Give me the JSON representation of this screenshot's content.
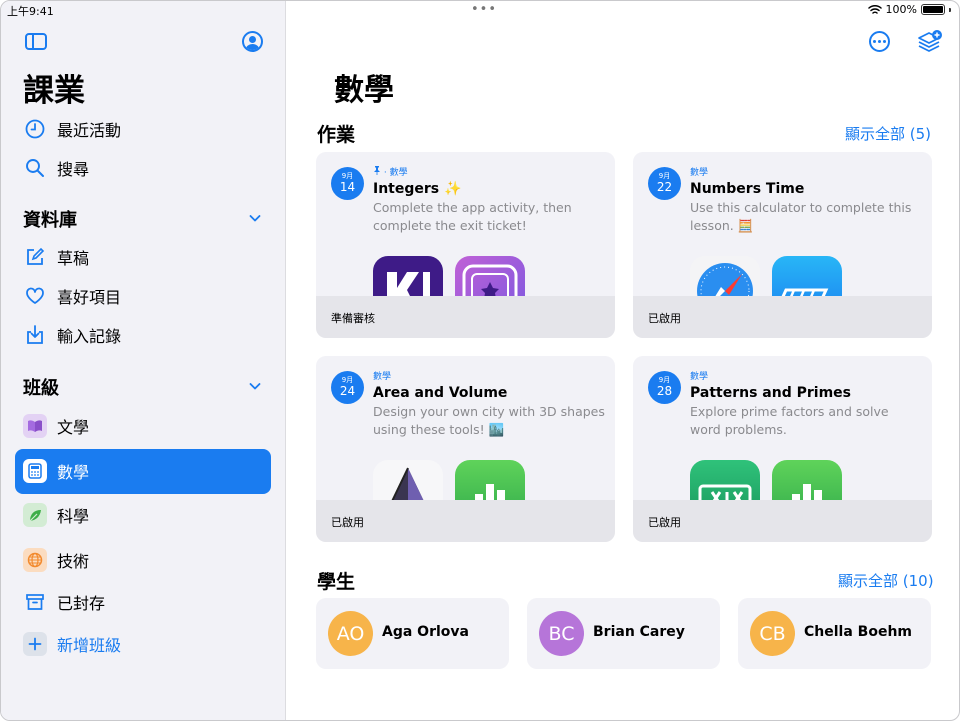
{
  "status_bar": {
    "time": "上午9:41",
    "battery": "100%"
  },
  "sidebar": {
    "title": "課業",
    "nav": [
      {
        "label": "最近活動",
        "icon": "clock-icon"
      },
      {
        "label": "搜尋",
        "icon": "search-icon"
      }
    ],
    "library": {
      "heading": "資料庫",
      "items": [
        {
          "label": "草稿",
          "icon": "compose-icon"
        },
        {
          "label": "喜好項目",
          "icon": "heart-icon"
        },
        {
          "label": "輸入記錄",
          "icon": "import-icon"
        }
      ]
    },
    "classes": {
      "heading": "班級",
      "items": [
        {
          "label": "文學",
          "icon": "book-icon",
          "color": "#a46be0"
        },
        {
          "label": "數學",
          "icon": "calculator-icon",
          "color": "#1a7cf0",
          "selected": true
        },
        {
          "label": "科學",
          "icon": "leaf-icon",
          "color": "#3fae49"
        },
        {
          "label": "技術",
          "icon": "globe-icon",
          "color": "#f28a2e"
        }
      ],
      "archived": "已封存",
      "add": "新增班級"
    }
  },
  "main": {
    "title": "數學",
    "assignments": {
      "heading": "作業",
      "show_all": "顯示全部 (5)",
      "cards": [
        {
          "month": "9月",
          "day": "14",
          "subject": "· 數學",
          "pinned": true,
          "title": "Integers ✨",
          "desc": "Complete the app activity, then complete the exit ticket!",
          "apps": [
            "kahoot-app-icon",
            "badge-app-icon"
          ],
          "status": "準備審核"
        },
        {
          "month": "9月",
          "day": "22",
          "subject": "數學",
          "pinned": false,
          "title": "Numbers Time",
          "desc": "Use this calculator to complete this lesson. 🧮",
          "apps": [
            "safari-app-icon",
            "keynote-app-icon"
          ],
          "status": "已啟用"
        },
        {
          "month": "9月",
          "day": "24",
          "subject": "數學",
          "pinned": false,
          "title": "Area and Volume",
          "desc": "Design your own city with 3D shapes using these tools! 🏙️",
          "apps": [
            "pyramid-app-icon",
            "numbers-app-icon"
          ],
          "status": "已啟用"
        },
        {
          "month": "9月",
          "day": "28",
          "subject": "數學",
          "pinned": false,
          "title": "Patterns and Primes",
          "desc": "Explore prime factors and solve word problems.",
          "apps": [
            "spreadsheet-app-icon",
            "numbers-app-icon"
          ],
          "status": "已啟用"
        }
      ]
    },
    "students": {
      "heading": "學生",
      "show_all": "顯示全部 (10)",
      "list": [
        {
          "initials": "AO",
          "name": "Aga Orlova",
          "color": "#f7b44a"
        },
        {
          "initials": "BC",
          "name": "Brian Carey",
          "color": "#b675d9"
        },
        {
          "initials": "CB",
          "name": "Chella Boehm",
          "color": "#f7b44a"
        }
      ]
    }
  }
}
